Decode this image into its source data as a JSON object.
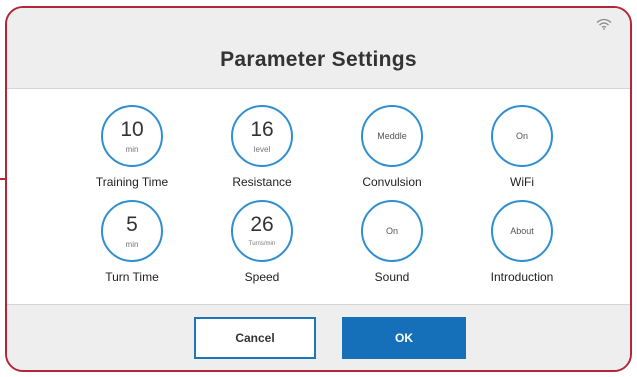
{
  "header": {
    "title": "Parameter Settings",
    "status_icon": "wifi-signal-icon"
  },
  "params": [
    {
      "value": "10",
      "unit": "min",
      "label": "Training Time"
    },
    {
      "value": "16",
      "unit": "level",
      "label": "Resistance"
    },
    {
      "state": "Meddle",
      "label": "Convulsion"
    },
    {
      "state": "On",
      "label": "WiFi"
    },
    {
      "value": "5",
      "unit": "min",
      "label": "Turn Time"
    },
    {
      "value": "26",
      "unit": "Turns/min",
      "label": "Speed"
    },
    {
      "state": "On",
      "label": "Sound"
    },
    {
      "state": "About",
      "label": "Introduction"
    }
  ],
  "footer": {
    "cancel_label": "Cancel",
    "ok_label": "OK"
  },
  "colors": {
    "accent": "#2f8fcf",
    "primary_button": "#1570b9",
    "frame_border": "#b3263a"
  }
}
